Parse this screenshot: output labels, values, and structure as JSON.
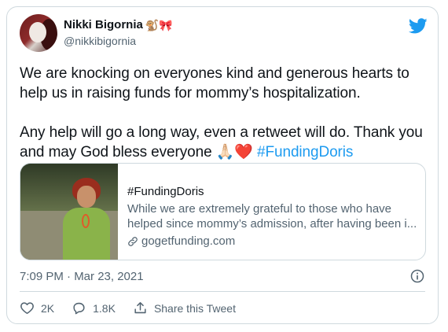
{
  "user": {
    "display_name": "Nikki Bigornia",
    "name_emojis": "🐒🎀",
    "handle": "@nikkibigornia"
  },
  "tweet": {
    "line1": "We are knocking on everyones kind and generous hearts to help us in raising funds for mommy’s hospitalization.",
    "line2_prefix": "Any help will go a long way, even a retweet will do. Thank you and may God bless everyone ",
    "prayer_emoji": "🙏🏻",
    "heart_emoji": "❤️",
    "hashtag": "#FundingDoris"
  },
  "link_card": {
    "title": "#FundingDoris",
    "description": "While we are extremely grateful to those who have helped since mommy’s admission, after having been i...",
    "domain": "gogetfunding.com"
  },
  "timestamp": "7:09 PM · Mar 23, 2021",
  "actions": {
    "likes": "2K",
    "replies": "1.8K",
    "share_label": "Share this Tweet"
  },
  "icons": {
    "brand": "twitter-bird-icon",
    "info": "info-icon",
    "like": "heart-icon",
    "reply": "reply-icon",
    "share": "share-icon",
    "link": "link-icon"
  },
  "colors": {
    "accent": "#1d9bf0",
    "text": "#0f1419",
    "muted": "#536471",
    "border": "#cfd9de"
  }
}
